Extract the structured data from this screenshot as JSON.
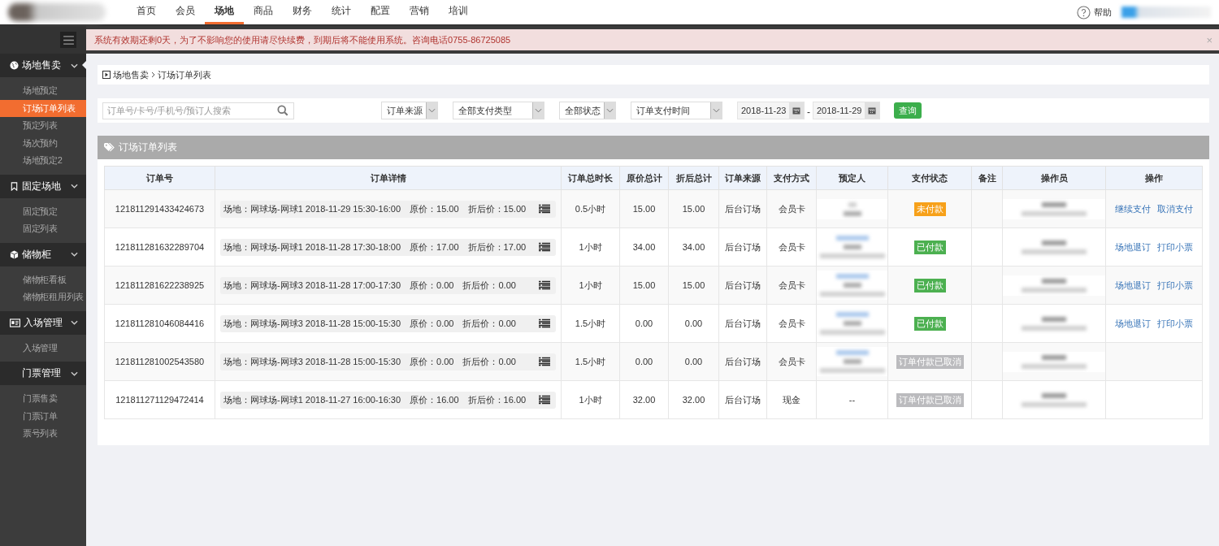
{
  "top_nav": {
    "items": [
      {
        "label": "首页",
        "selected": false
      },
      {
        "label": "会员",
        "selected": false
      },
      {
        "label": "场地",
        "selected": true
      },
      {
        "label": "商品",
        "selected": false
      },
      {
        "label": "财务",
        "selected": false
      },
      {
        "label": "统计",
        "selected": false
      },
      {
        "label": "配置",
        "selected": false
      },
      {
        "label": "营销",
        "selected": false
      },
      {
        "label": "培训",
        "selected": false
      }
    ],
    "help": "帮助"
  },
  "alert": {
    "text": "系统有效期还剩0天，为了不影响您的使用请尽快续费，到期后将不能使用系统。咨询电话0755-86725085",
    "close": "×"
  },
  "sidebar": {
    "groups": [
      {
        "label": "场地售卖",
        "expanded": true,
        "selected": true,
        "children": [
          {
            "label": "场地预定",
            "selected": false
          },
          {
            "label": "订场订单列表",
            "selected": true
          },
          {
            "label": "预定列表",
            "selected": false
          },
          {
            "label": "场次预约",
            "selected": false
          },
          {
            "label": "场地预定2",
            "selected": false
          }
        ]
      },
      {
        "label": "固定场地",
        "expanded": true,
        "selected": false,
        "children": [
          {
            "label": "固定预定",
            "selected": false
          },
          {
            "label": "固定列表",
            "selected": false
          }
        ]
      },
      {
        "label": "储物柜",
        "expanded": true,
        "selected": false,
        "children": [
          {
            "label": "储物柜看板",
            "selected": false
          },
          {
            "label": "储物柜租用列表",
            "selected": false
          }
        ]
      },
      {
        "label": "入场管理",
        "expanded": true,
        "selected": false,
        "children": [
          {
            "label": "入场管理",
            "selected": false
          }
        ]
      },
      {
        "label": "门票管理",
        "expanded": true,
        "selected": false,
        "children": [
          {
            "label": "门票售卖",
            "selected": false
          },
          {
            "label": "门票订单",
            "selected": false
          },
          {
            "label": "票号列表",
            "selected": false
          }
        ]
      }
    ]
  },
  "breadcrumb": [
    "场地售卖",
    "订场订单列表"
  ],
  "filters": {
    "search": {
      "placeholder": "订单号/卡号/手机号/预订人搜索"
    },
    "selects": [
      "订单来源",
      "全部支付类型",
      "全部状态",
      "订单支付时间"
    ],
    "date_from": "2018-11-23",
    "date_sep": "-",
    "date_to": "2018-11-29",
    "query": "查询"
  },
  "panel": {
    "title": "订场订单列表"
  },
  "table": {
    "columns": [
      "订单号",
      "订单详情",
      "订单总时长",
      "原价总计",
      "折后总计",
      "订单来源",
      "支付方式",
      "预定人",
      "支付状态",
      "备注",
      "操作员",
      "操作"
    ],
    "rows": [
      {
        "order_no": "121811291433424673",
        "venue": "场地：网球场-网球1 2018-11-29 15:30-16:00",
        "price": "原价：15.00",
        "discount": "折后价：15.00",
        "duration": "0.5小时",
        "total": "15.00",
        "discount_total": "15.00",
        "source": "后台订场",
        "payment": "会员卡",
        "booker": {
          "kind": "redacted_name"
        },
        "status": {
          "kind": "unpaid",
          "text": "未付款"
        },
        "actions": [
          "继续支付",
          "取消支付"
        ]
      },
      {
        "order_no": "121811281632289704",
        "venue": "场地：网球场-网球1 2018-11-28 17:30-18:00",
        "price": "原价：17.00",
        "discount": "折后价：17.00",
        "duration": "1小时",
        "total": "34.00",
        "discount_total": "34.00",
        "source": "后台订场",
        "payment": "会员卡",
        "booker": {
          "kind": "redacted_contact"
        },
        "status": {
          "kind": "paid",
          "text": "已付款"
        },
        "actions": [
          "场地退订",
          "打印小票"
        ]
      },
      {
        "order_no": "121811281622238925",
        "venue": "场地：网球场-网球3 2018-11-28 17:00-17:30",
        "price": "原价：0.00",
        "discount": "折后价：0.00",
        "duration": "1小时",
        "total": "15.00",
        "discount_total": "15.00",
        "source": "后台订场",
        "payment": "会员卡",
        "booker": {
          "kind": "redacted_contact"
        },
        "status": {
          "kind": "paid",
          "text": "已付款"
        },
        "actions": [
          "场地退订",
          "打印小票"
        ]
      },
      {
        "order_no": "121811281046084416",
        "venue": "场地：网球场-网球3 2018-11-28 15:00-15:30",
        "price": "原价：0.00",
        "discount": "折后价：0.00",
        "duration": "1.5小时",
        "total": "0.00",
        "discount_total": "0.00",
        "source": "后台订场",
        "payment": "会员卡",
        "booker": {
          "kind": "redacted_contact"
        },
        "status": {
          "kind": "paid",
          "text": "已付款"
        },
        "actions": [
          "场地退订",
          "打印小票"
        ]
      },
      {
        "order_no": "121811281002543580",
        "venue": "场地：网球场-网球3 2018-11-28 15:00-15:30",
        "price": "原价：0.00",
        "discount": "折后价：0.00",
        "duration": "1.5小时",
        "total": "0.00",
        "discount_total": "0.00",
        "source": "后台订场",
        "payment": "会员卡",
        "booker": {
          "kind": "redacted_contact"
        },
        "status": {
          "kind": "cancelled",
          "text": "订单付款已取消"
        }
      },
      {
        "order_no": "121811271129472414",
        "venue": "场地：网球场-网球1 2018-11-27 16:00-16:30",
        "price": "原价：16.00",
        "discount": "折后价：16.00",
        "duration": "1小时",
        "total": "32.00",
        "discount_total": "32.00",
        "source": "后台订场",
        "payment": "现金",
        "booker": {
          "kind": "text",
          "text": "--"
        },
        "status": {
          "kind": "cancelled",
          "text": "订单付款已取消"
        }
      }
    ]
  }
}
